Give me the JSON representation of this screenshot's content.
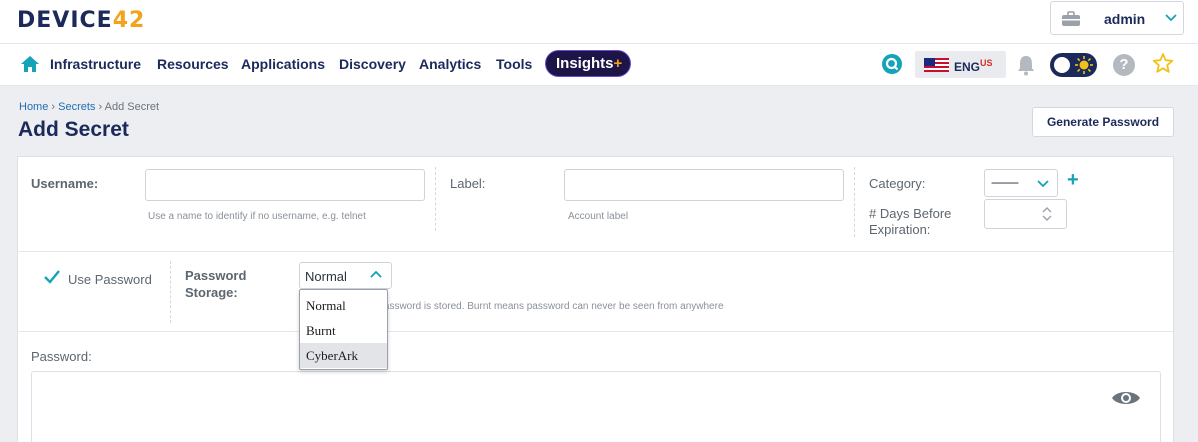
{
  "app": {
    "logo_text": "DEVICE",
    "logo_num": "42",
    "user": "admin"
  },
  "nav": {
    "items": [
      "Infrastructure",
      "Resources",
      "Applications",
      "Discovery",
      "Analytics",
      "Tools"
    ],
    "insights_label": "Insights",
    "insights_plus": "+",
    "lang": "ENG",
    "lang_sup": "US",
    "help": "?"
  },
  "page": {
    "breadcrumb": [
      "Home",
      "Secrets",
      "Add Secret"
    ],
    "breadcrumb_sep": "›",
    "title": "Add Secret",
    "generate_password": "Generate Password"
  },
  "form": {
    "username_label": "Username:",
    "username_value": "",
    "username_help": "Use a name to identify if no username, e.g. telnet",
    "label_label": "Label:",
    "label_value": "",
    "label_help": "Account label",
    "category_label": "Category:",
    "category_value": "---------",
    "days_label_1": "# Days Before",
    "days_label_2": "Expiration:",
    "days_value": "",
    "use_password_label": "Use Password",
    "use_password_checked": true,
    "storage_label_1": "Password",
    "storage_label_2": "Storage:",
    "storage_value": "Normal",
    "storage_help": "e password is stored. Burnt means password can never be seen from anywhere",
    "storage_options": [
      "Normal",
      "Burnt",
      "CyberArk"
    ],
    "storage_highlighted": "CyberArk",
    "password_label": "Password:",
    "password_value": ""
  },
  "colors": {
    "brand_dark": "#1b2a5a",
    "brand_accent": "#f2a21b",
    "teal": "#14a3b8",
    "insights_bg": "#1d1547"
  },
  "icons": [
    "briefcase-icon",
    "chevron-down-icon",
    "home-icon",
    "search-icon",
    "flag-icon",
    "bell-icon",
    "sun-icon",
    "help-icon",
    "star-icon",
    "plus-icon",
    "check-icon",
    "chevron-up-icon",
    "spinner-icon",
    "eye-icon"
  ]
}
